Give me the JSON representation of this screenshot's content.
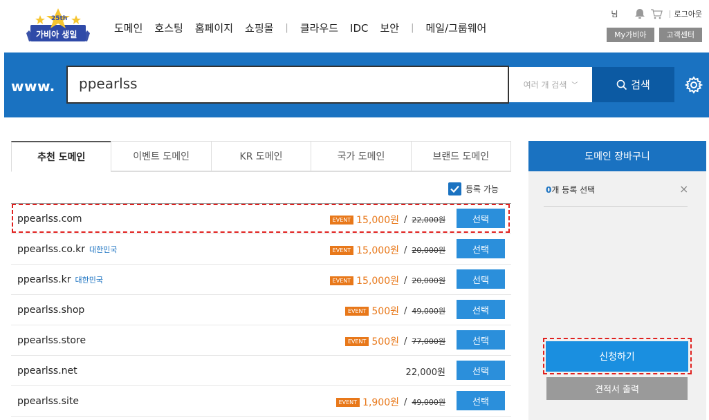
{
  "logo": {
    "badge": "25th",
    "text": "가비아 생일"
  },
  "nav": {
    "group1": [
      "도메인",
      "호스팅",
      "홈페이지",
      "쇼핑몰"
    ],
    "separator": "|",
    "group2": [
      "클라우드",
      "IDC",
      "보안"
    ],
    "group3": [
      "메일/그룹웨어"
    ]
  },
  "util": {
    "user_suffix": "님",
    "logout": "로그아웃",
    "my_label": "My가비아",
    "support_label": "고객센터"
  },
  "search": {
    "prefix": "www.",
    "query": "ppearlss",
    "multi_label": "여러 개 검색",
    "button_label": "검색"
  },
  "tabs": [
    "추천 도메인",
    "이벤트 도메인",
    "KR 도메인",
    "국가 도메인",
    "브랜드 도메인"
  ],
  "filter": {
    "available_label": "등록 가능",
    "checked": true
  },
  "event_tag": "EVENT",
  "select_label": "선택",
  "domains": [
    {
      "name": "ppearlss.com",
      "tag": "",
      "event": true,
      "price": "15,000원",
      "original": "22,000원"
    },
    {
      "name": "ppearlss.co.kr",
      "tag": "대한민국",
      "event": true,
      "price": "15,000원",
      "original": "20,000원"
    },
    {
      "name": "ppearlss.kr",
      "tag": "대한민국",
      "event": true,
      "price": "15,000원",
      "original": "20,000원"
    },
    {
      "name": "ppearlss.shop",
      "tag": "",
      "event": true,
      "price": "500원",
      "original": "49,000원"
    },
    {
      "name": "ppearlss.store",
      "tag": "",
      "event": true,
      "price": "500원",
      "original": "77,000원"
    },
    {
      "name": "ppearlss.net",
      "tag": "",
      "event": false,
      "price": "22,000원",
      "original": ""
    },
    {
      "name": "ppearlss.site",
      "tag": "",
      "event": true,
      "price": "1,900원",
      "original": "49,000원"
    }
  ],
  "cart": {
    "title": "도메인 장바구니",
    "count": "0",
    "count_suffix": "개 등록 선택",
    "close": "×",
    "apply_label": "신청하기",
    "quote_label": "견적서 출력"
  },
  "colors": {
    "brand_blue": "#1a72c1",
    "dark_blue": "#0c5aa3",
    "event_orange": "#e8781a",
    "highlight_red": "#e0201e"
  }
}
